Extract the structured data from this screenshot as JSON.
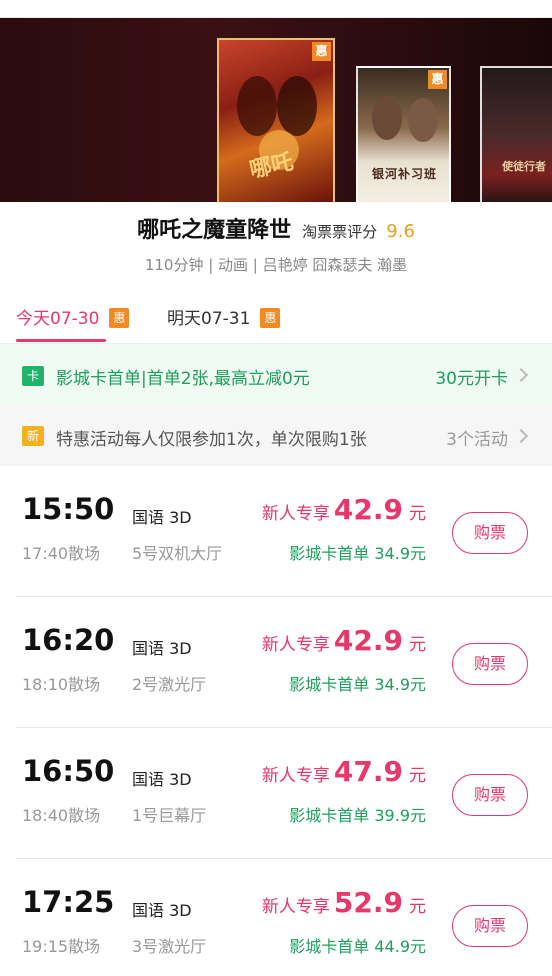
{
  "banner": {
    "posters": [
      {
        "badge": "惠"
      },
      {
        "badge": "惠"
      }
    ]
  },
  "movie": {
    "title": "哪吒之魔童降世",
    "rating_label": "淘票票评分",
    "rating_value": "9.6",
    "meta": "110分钟 | 动画 | 吕艳婷 囧森瑟夫 瀚墨"
  },
  "tabs": [
    {
      "label": "今天07-30",
      "badge": "惠",
      "active": true
    },
    {
      "label": "明天07-31",
      "badge": "惠",
      "active": false
    }
  ],
  "card_promo": {
    "icon": "卡",
    "text": "影城卡首单|首单2张,最高立减0元",
    "action": "30元开卡"
  },
  "activity_promo": {
    "icon": "新",
    "text": "特惠活动每人仅限参加1次，单次限购1张",
    "count": "3个活动"
  },
  "sessions": [
    {
      "start": "15:50",
      "end": "17:40散场",
      "lang": "国语 3D",
      "hall": "5号双机大厅",
      "price_prefix": "新人专享",
      "price": "42.9",
      "price_unit": "元",
      "card_price": "影城卡首单 34.9元",
      "button": "购票"
    },
    {
      "start": "16:20",
      "end": "18:10散场",
      "lang": "国语 3D",
      "hall": "2号激光厅",
      "price_prefix": "新人专享",
      "price": "42.9",
      "price_unit": "元",
      "card_price": "影城卡首单 34.9元",
      "button": "购票"
    },
    {
      "start": "16:50",
      "end": "18:40散场",
      "lang": "国语 3D",
      "hall": "1号巨幕厅",
      "price_prefix": "新人专享",
      "price": "47.9",
      "price_unit": "元",
      "card_price": "影城卡首单 39.9元",
      "button": "购票"
    },
    {
      "start": "17:25",
      "end": "19:15散场",
      "lang": "国语 3D",
      "hall": "3号激光厅",
      "price_prefix": "新人专享",
      "price": "52.9",
      "price_unit": "元",
      "card_price": "影城卡首单 44.9元",
      "button": "购票"
    }
  ],
  "colors": {
    "accent": "#e8386b",
    "green": "#1f9e5c",
    "rating": "#e8a21e",
    "badge_orange": "#ef8a24"
  }
}
